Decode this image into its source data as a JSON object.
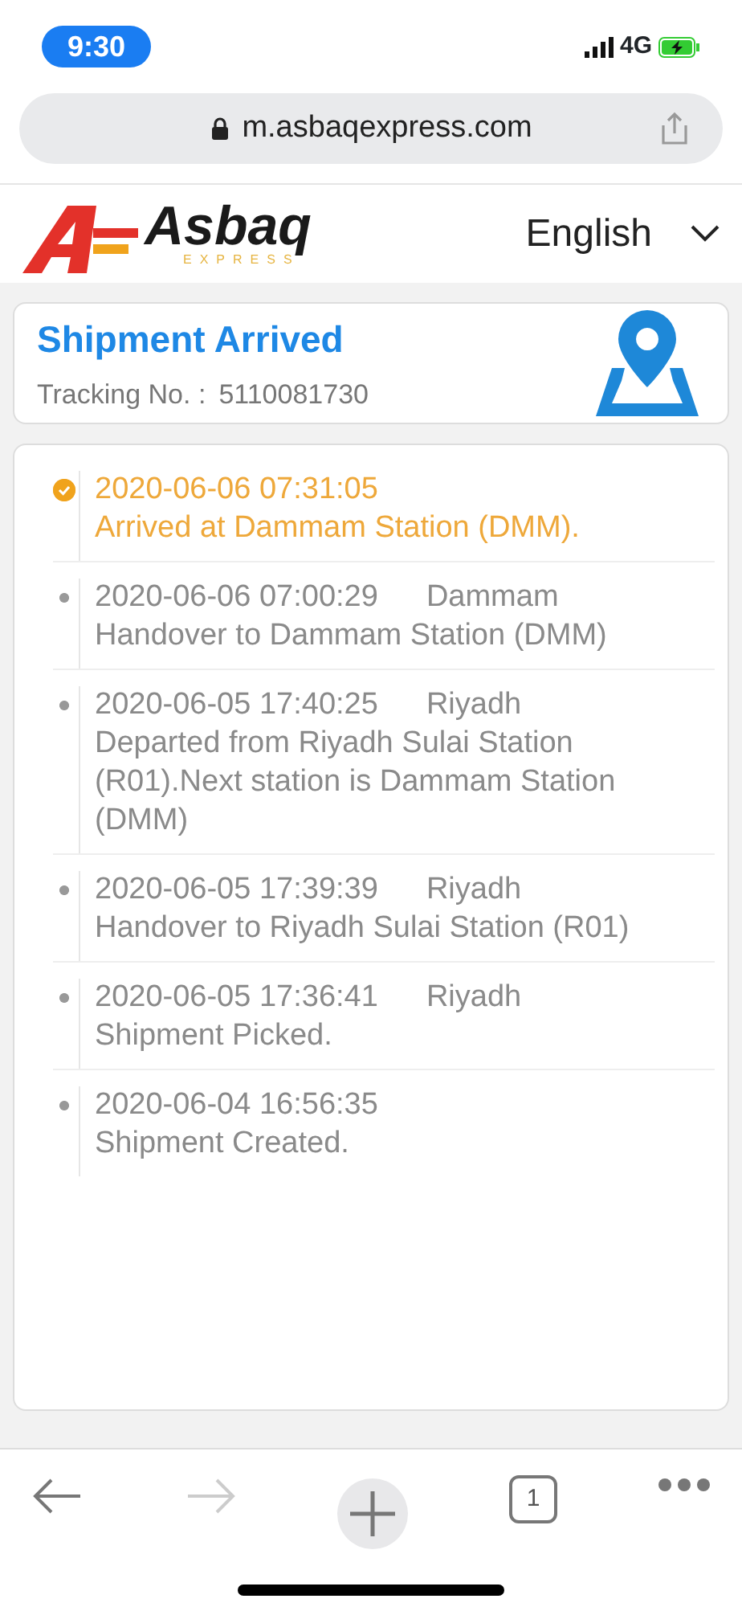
{
  "status_bar": {
    "time": "9:30",
    "network": "4G"
  },
  "browser": {
    "url": "m.asbaqexpress.com",
    "tab_count": "1"
  },
  "header": {
    "logo_name": "Asbaq",
    "logo_tagline": "EXPRESS",
    "language": "English"
  },
  "summary": {
    "title": "Shipment Arrived",
    "tracking_label": "Tracking No. :",
    "tracking_number": "5110081730"
  },
  "events": [
    {
      "time": "2020-06-06 07:31:05",
      "text": "Arrived at Dammam Station (DMM).",
      "current": true
    },
    {
      "time": "2020-06-06 07:00:29",
      "place": "Dammam",
      "text": "Handover to Dammam Station (DMM)",
      "current": false
    },
    {
      "time": "2020-06-05 17:40:25",
      "place": "Riyadh",
      "text": "Departed from Riyadh Sulai Station (R01).Next station is Dammam Station (DMM)",
      "current": false
    },
    {
      "time": "2020-06-05 17:39:39",
      "place": "Riyadh",
      "text": "Handover to Riyadh Sulai Station (R01)",
      "current": false
    },
    {
      "time": "2020-06-05 17:36:41",
      "place": "Riyadh",
      "text": "Shipment Picked.",
      "current": false
    },
    {
      "time": "2020-06-04 16:56:35",
      "text": "Shipment Created.",
      "current": false
    }
  ]
}
